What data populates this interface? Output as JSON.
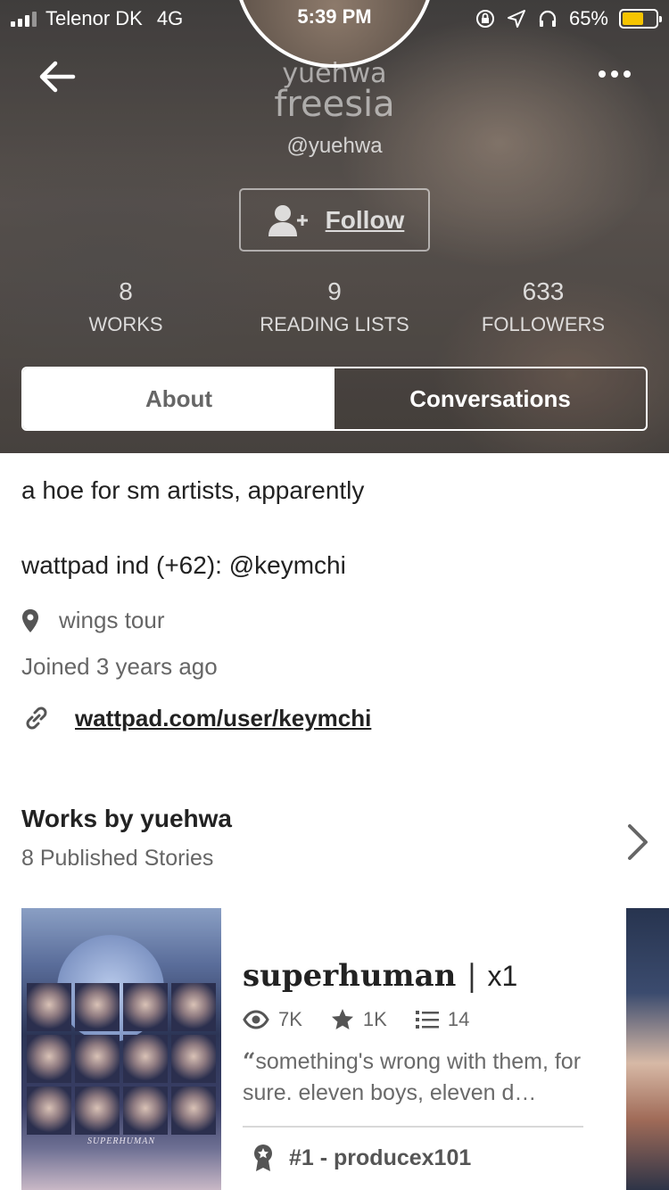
{
  "status_bar": {
    "carrier": "Telenor DK",
    "network": "4G",
    "time": "5:39 PM",
    "battery": "65%",
    "battery_level": 0.65,
    "battery_color": "#f5c400"
  },
  "header": {
    "name_small": "yuehwa",
    "name_big": "freesia",
    "handle": "@yuehwa",
    "follow_label": "Follow",
    "stats": [
      {
        "value": "8",
        "label": "WORKS"
      },
      {
        "value": "9",
        "label": "READING LISTS"
      },
      {
        "value": "633",
        "label": "FOLLOWERS"
      }
    ],
    "tabs": [
      {
        "label": "About",
        "active": true
      },
      {
        "label": "Conversations",
        "active": false
      }
    ]
  },
  "about": {
    "bio_line1": "a hoe for sm artists, apparently",
    "bio_line2": "wattpad ind (+62): @keymchi",
    "location": "wings tour",
    "joined": "Joined 3 years ago",
    "link": "wattpad.com/user/keymchi"
  },
  "works": {
    "title": "Works by yuehwa",
    "subtitle": "8 Published Stories",
    "stories": [
      {
        "cover_text": "SUPERHUMAN",
        "title": "superhuman",
        "separator": "|",
        "title_suffix": "x1",
        "reads": "7K",
        "votes": "1K",
        "parts": "14",
        "open_quote": "“",
        "description": "something's wrong with them, for sure. eleven boys, eleven d…",
        "rank": "#1 - producex101"
      }
    ]
  },
  "icons": {
    "back": "arrow-left-icon",
    "more": "more-dots-icon",
    "follow": "add-person-icon",
    "location": "map-pin-icon",
    "link": "link-icon",
    "chevron": "chevron-right-icon",
    "reads": "eye-icon",
    "votes": "star-icon",
    "parts": "list-icon",
    "rank": "ribbon-icon"
  }
}
